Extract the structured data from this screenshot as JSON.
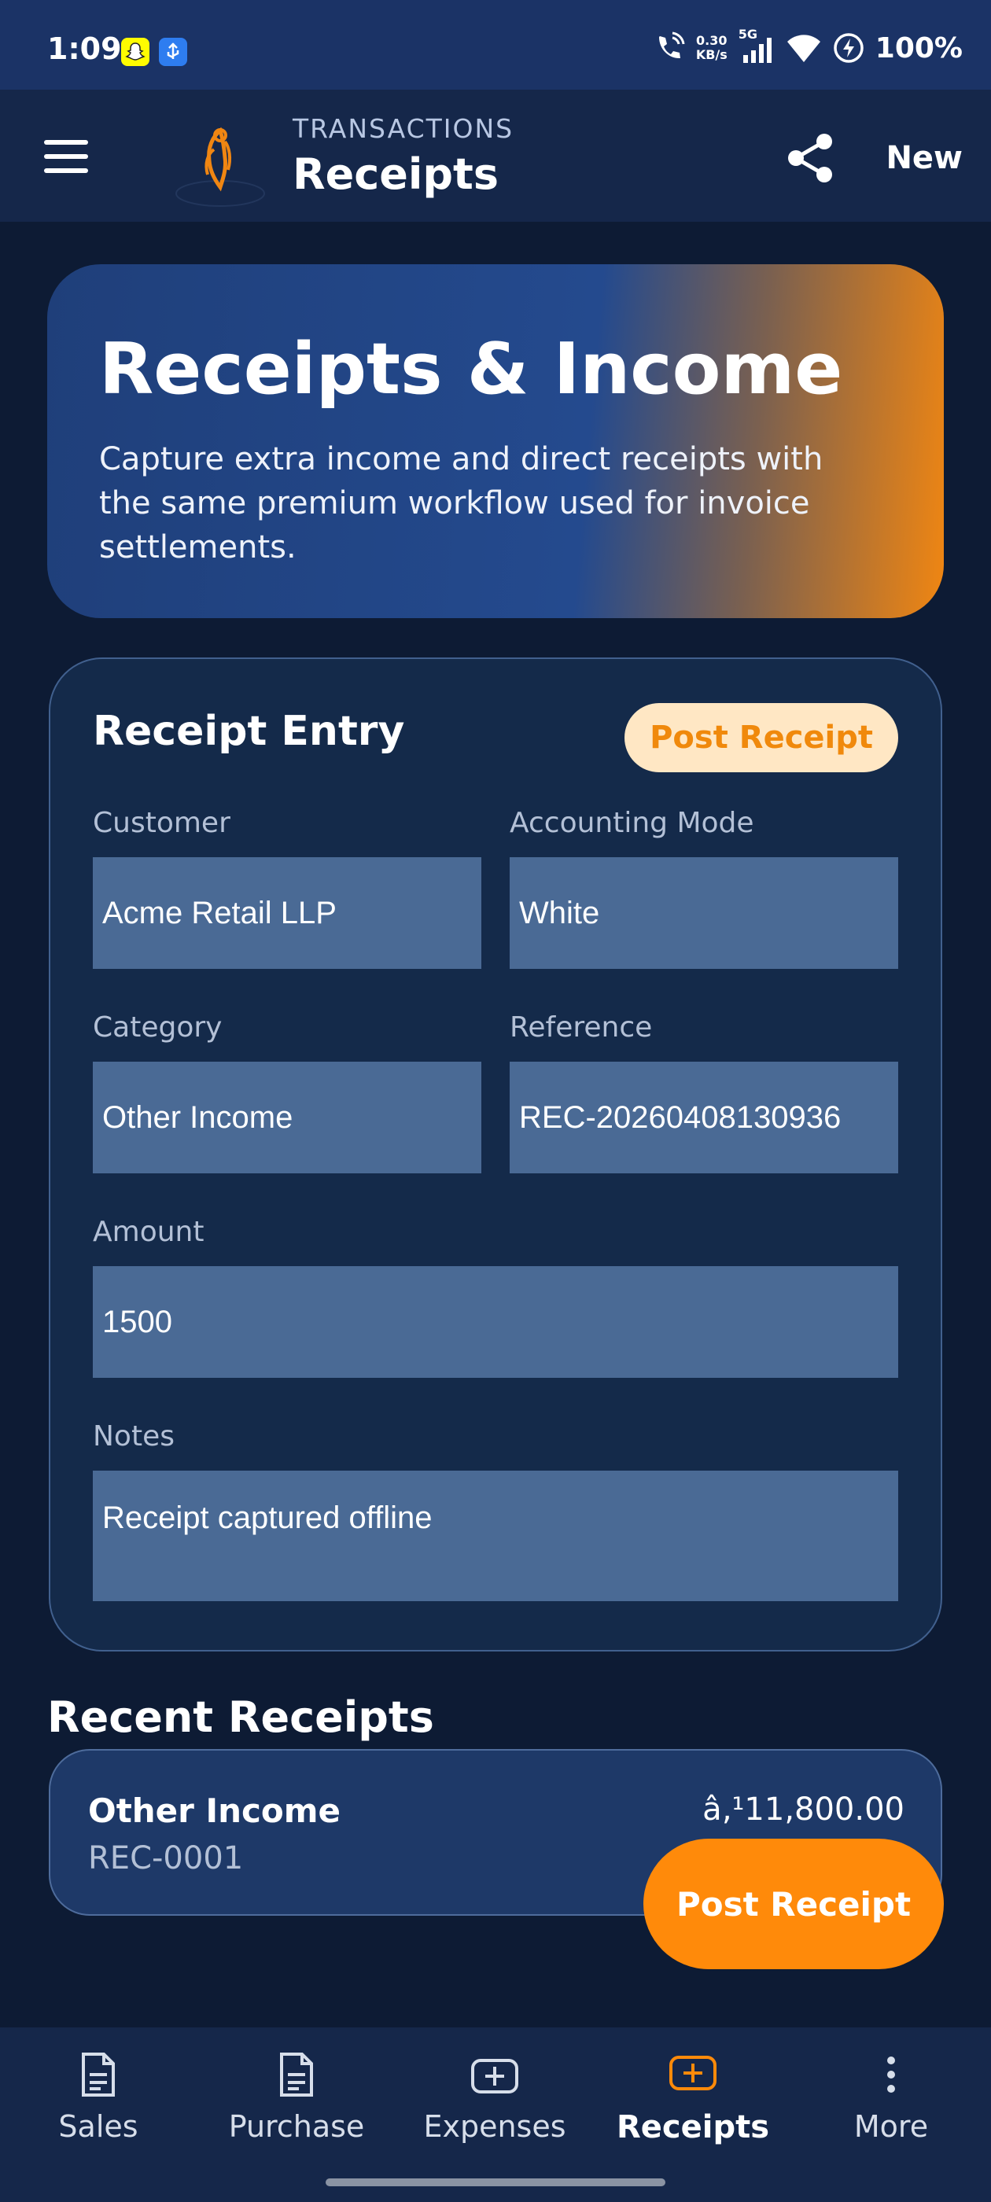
{
  "status_bar": {
    "time": "1:09",
    "net_speed_value": "0.30",
    "net_speed_unit": "KB/s",
    "network_gen": "5G",
    "battery": "100%",
    "icons": [
      "snapchat-icon",
      "usb-icon",
      "call-icon",
      "signal-icon",
      "wifi-icon",
      "charging-icon"
    ]
  },
  "app_bar": {
    "overline": "TRANSACTIONS",
    "title": "Receipts",
    "new_label": "New",
    "icons": [
      "menu-icon",
      "logo-icon",
      "share-icon"
    ]
  },
  "hero": {
    "title": "Receipts & Income",
    "subtitle": "Capture extra income and direct receipts with the same premium workflow used for invoice settlements."
  },
  "entry_form": {
    "title": "Receipt Entry",
    "post_label": "Post Receipt",
    "customer": {
      "label": "Customer",
      "value": "Acme Retail LLP"
    },
    "accounting_mode": {
      "label": "Accounting Mode",
      "value": "White"
    },
    "category": {
      "label": "Category",
      "value": "Other Income"
    },
    "reference": {
      "label": "Reference",
      "value": "REC-20260408130936"
    },
    "amount": {
      "label": "Amount",
      "value": "1500"
    },
    "notes": {
      "label": "Notes",
      "value": "Receipt captured offline"
    }
  },
  "recent": {
    "title": "Recent Receipts",
    "items": [
      {
        "category": "Other Income",
        "reference": "REC-0001",
        "amount": "â‚¹11,800.00"
      }
    ]
  },
  "fab": {
    "label": "Post Receipt"
  },
  "bottom_nav": {
    "items": [
      {
        "label": "Sales",
        "icon": "document-icon"
      },
      {
        "label": "Purchase",
        "icon": "document-icon"
      },
      {
        "label": "Expenses",
        "icon": "add-box-icon"
      },
      {
        "label": "Receipts",
        "icon": "add-box-icon",
        "active": true
      },
      {
        "label": "More",
        "icon": "more-vertical-icon"
      }
    ]
  },
  "colors": {
    "background": "#0d1b34",
    "accent": "#ff8a0a",
    "card": "#142a4a",
    "input": "#4a6a95"
  }
}
